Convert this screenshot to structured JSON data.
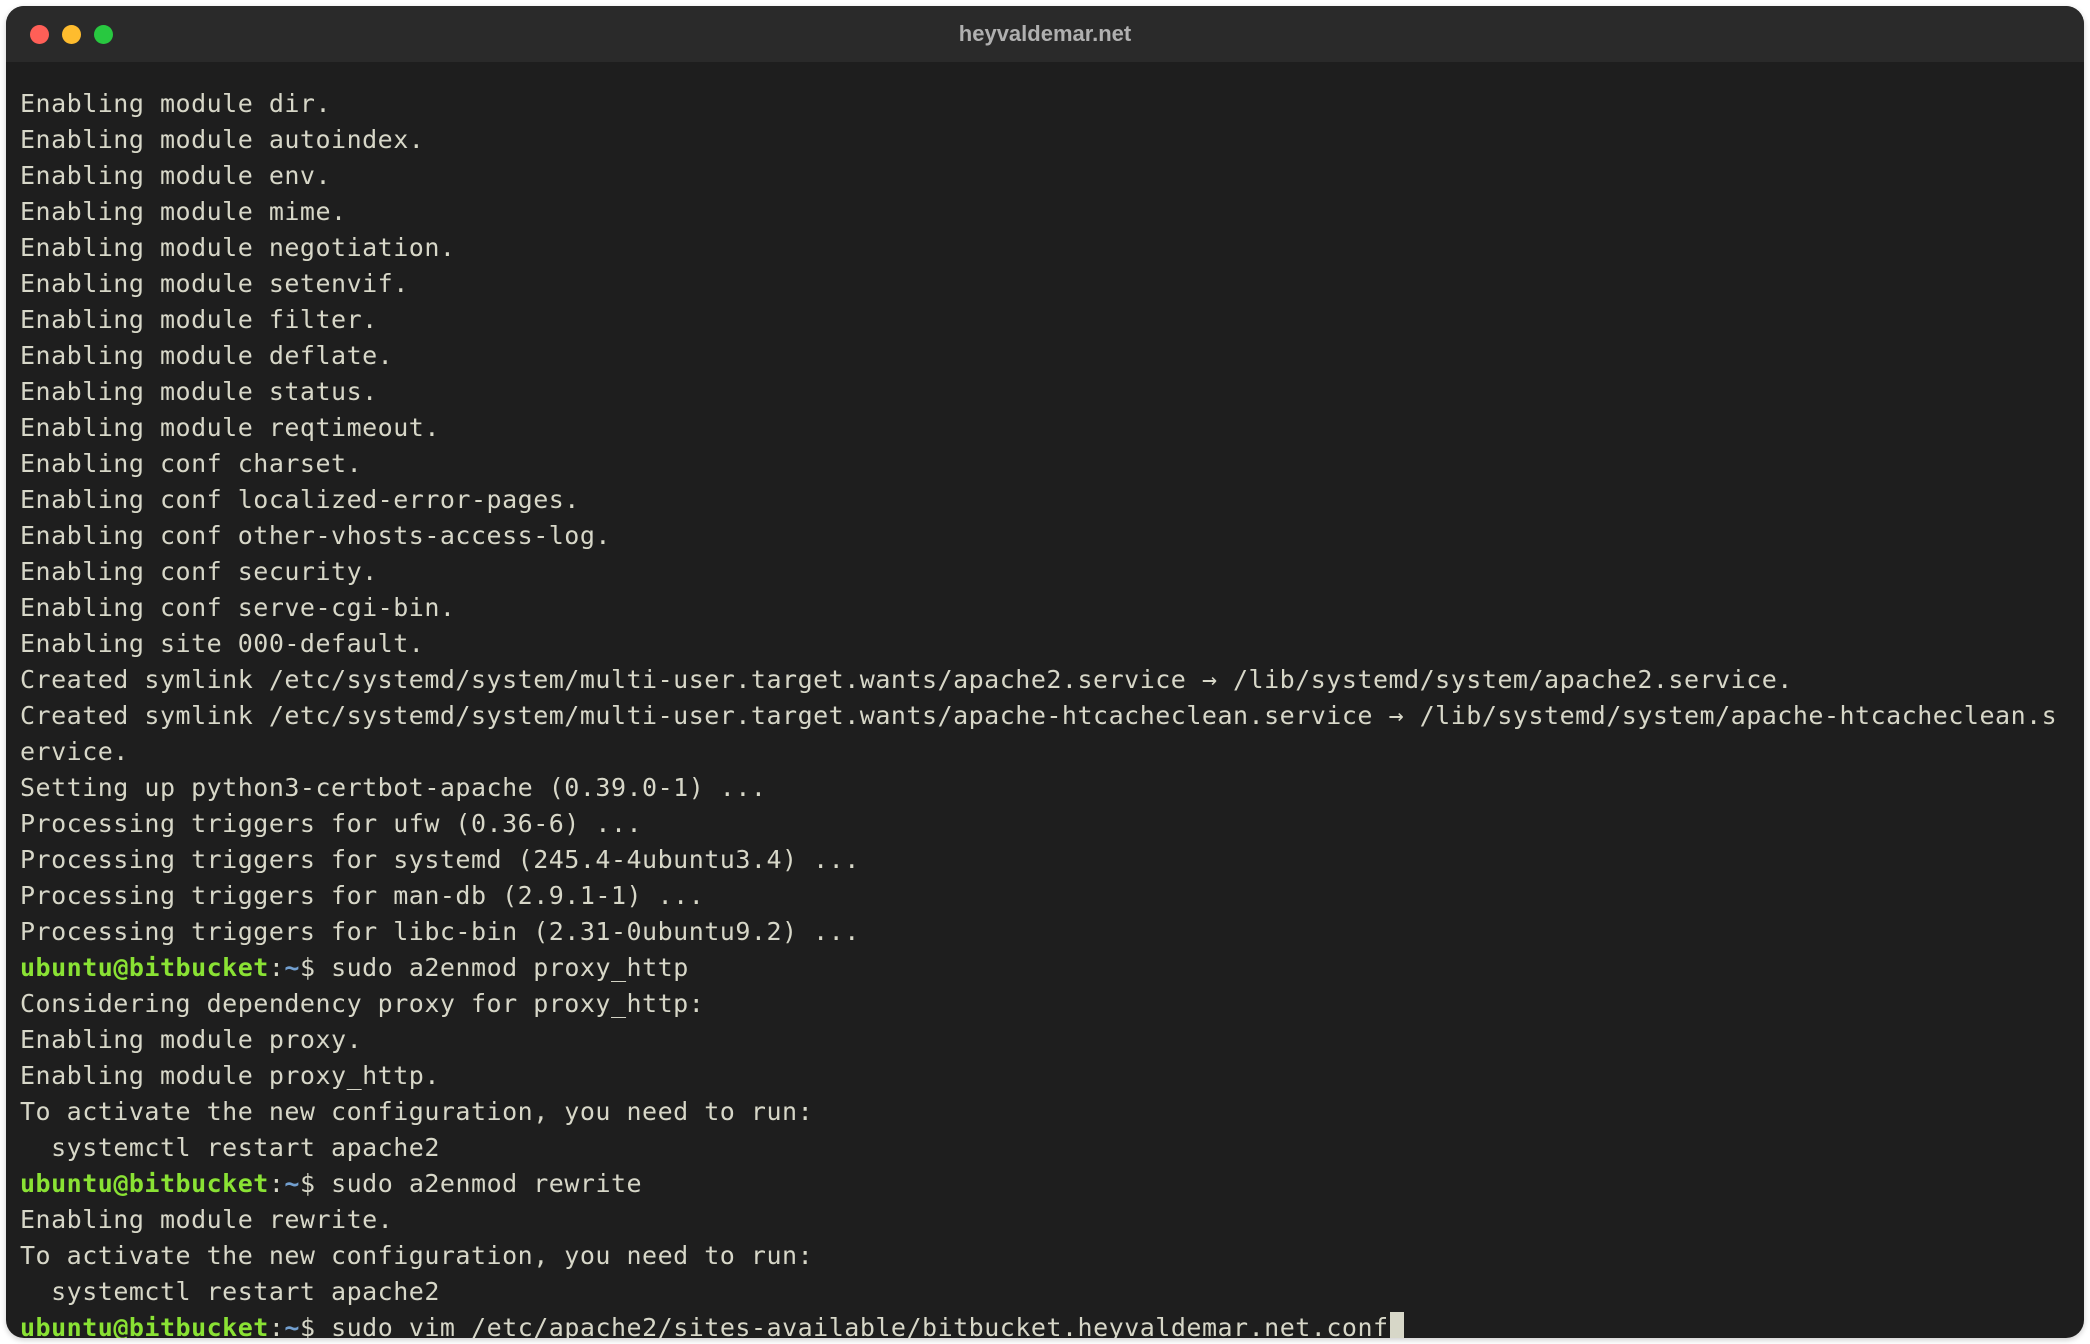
{
  "window": {
    "title": "heyvaldemar.net"
  },
  "prompt": {
    "user": "ubuntu",
    "host": "bitbucket",
    "path": "~",
    "symbol": "$"
  },
  "lines": [
    {
      "type": "out",
      "text": "Enabling module dir."
    },
    {
      "type": "out",
      "text": "Enabling module autoindex."
    },
    {
      "type": "out",
      "text": "Enabling module env."
    },
    {
      "type": "out",
      "text": "Enabling module mime."
    },
    {
      "type": "out",
      "text": "Enabling module negotiation."
    },
    {
      "type": "out",
      "text": "Enabling module setenvif."
    },
    {
      "type": "out",
      "text": "Enabling module filter."
    },
    {
      "type": "out",
      "text": "Enabling module deflate."
    },
    {
      "type": "out",
      "text": "Enabling module status."
    },
    {
      "type": "out",
      "text": "Enabling module reqtimeout."
    },
    {
      "type": "out",
      "text": "Enabling conf charset."
    },
    {
      "type": "out",
      "text": "Enabling conf localized-error-pages."
    },
    {
      "type": "out",
      "text": "Enabling conf other-vhosts-access-log."
    },
    {
      "type": "out",
      "text": "Enabling conf security."
    },
    {
      "type": "out",
      "text": "Enabling conf serve-cgi-bin."
    },
    {
      "type": "out",
      "text": "Enabling site 000-default."
    },
    {
      "type": "out",
      "text": "Created symlink /etc/systemd/system/multi-user.target.wants/apache2.service → /lib/systemd/system/apache2.service."
    },
    {
      "type": "out",
      "text": "Created symlink /etc/systemd/system/multi-user.target.wants/apache-htcacheclean.service → /lib/systemd/system/apache-htcacheclean.service."
    },
    {
      "type": "out",
      "text": "Setting up python3-certbot-apache (0.39.0-1) ..."
    },
    {
      "type": "out",
      "text": "Processing triggers for ufw (0.36-6) ..."
    },
    {
      "type": "out",
      "text": "Processing triggers for systemd (245.4-4ubuntu3.4) ..."
    },
    {
      "type": "out",
      "text": "Processing triggers for man-db (2.9.1-1) ..."
    },
    {
      "type": "out",
      "text": "Processing triggers for libc-bin (2.31-0ubuntu9.2) ..."
    },
    {
      "type": "cmd",
      "text": "sudo a2enmod proxy_http"
    },
    {
      "type": "out",
      "text": "Considering dependency proxy for proxy_http:"
    },
    {
      "type": "out",
      "text": "Enabling module proxy."
    },
    {
      "type": "out",
      "text": "Enabling module proxy_http."
    },
    {
      "type": "out",
      "text": "To activate the new configuration, you need to run:"
    },
    {
      "type": "out",
      "text": "  systemctl restart apache2"
    },
    {
      "type": "cmd",
      "text": "sudo a2enmod rewrite"
    },
    {
      "type": "out",
      "text": "Enabling module rewrite."
    },
    {
      "type": "out",
      "text": "To activate the new configuration, you need to run:"
    },
    {
      "type": "out",
      "text": "  systemctl restart apache2"
    },
    {
      "type": "cmd",
      "text": "sudo vim /etc/apache2/sites-available/bitbucket.heyvaldemar.net.conf",
      "cursor": true
    }
  ]
}
